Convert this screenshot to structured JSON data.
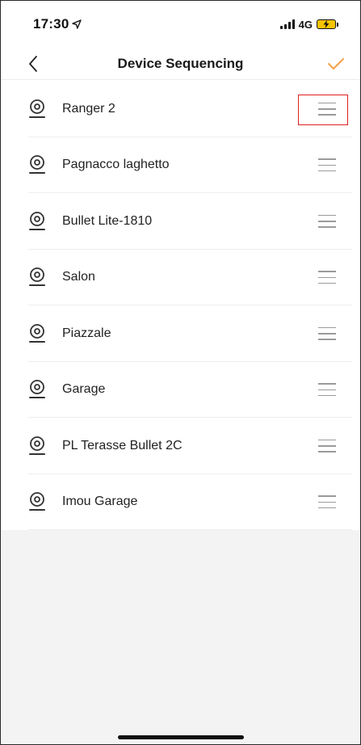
{
  "status_bar": {
    "time": "17:30",
    "location_icon": "location-arrow-icon",
    "signal_icon": "signal-bars-icon",
    "network": "4G",
    "battery_icon": "battery-charging-icon",
    "battery_color": "#f5c400"
  },
  "nav": {
    "title": "Device Sequencing",
    "back_icon": "chevron-left-icon",
    "confirm_icon": "checkmark-icon",
    "accent_color": "#f5a04a"
  },
  "devices": [
    {
      "name": "Ranger 2"
    },
    {
      "name": "Pagnacco laghetto"
    },
    {
      "name": "Bullet Lite-1810"
    },
    {
      "name": "Salon"
    },
    {
      "name": "Piazzale"
    },
    {
      "name": "Garage"
    },
    {
      "name": "PL Terasse Bullet 2C"
    },
    {
      "name": "Imou Garage"
    }
  ],
  "row_icons": {
    "device_icon": "camera-icon",
    "handle_icon": "drag-handle-icon"
  },
  "highlight": {
    "target": "drag-handle of first row",
    "color": "#e02020"
  }
}
